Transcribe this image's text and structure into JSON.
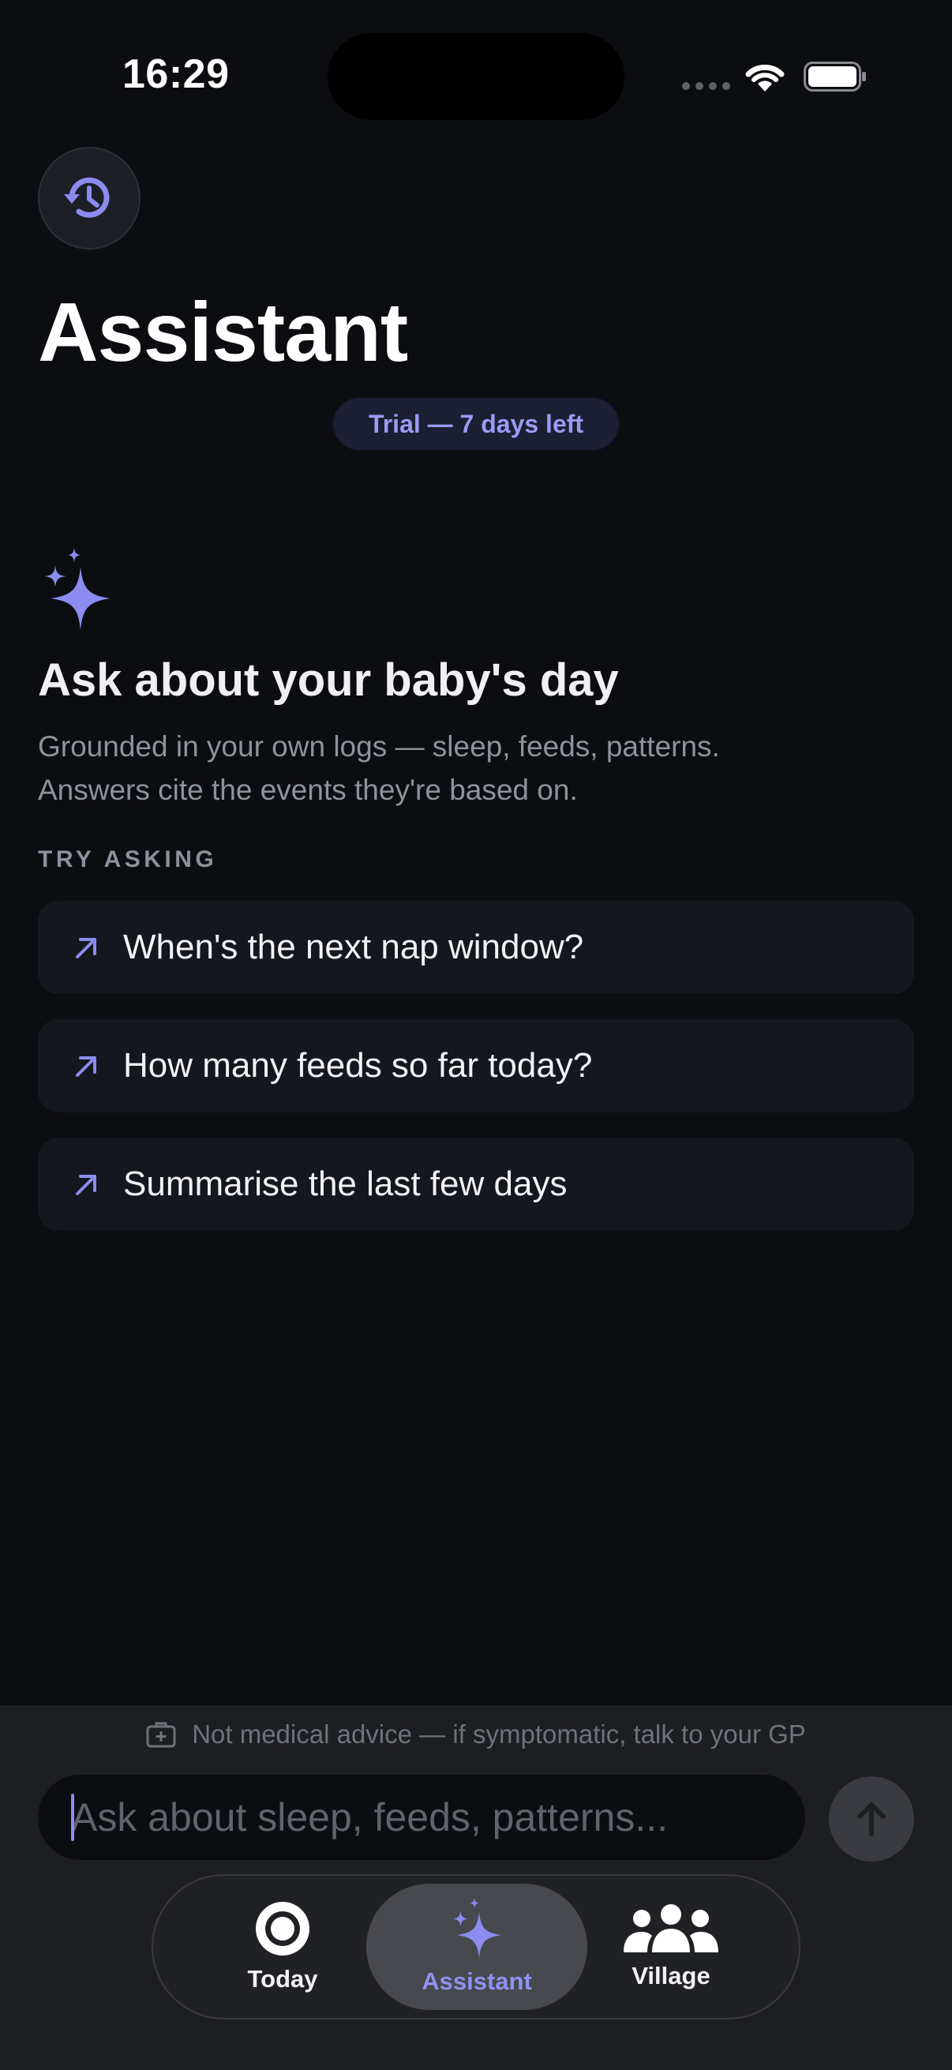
{
  "status_bar": {
    "time": "16:29"
  },
  "header": {
    "title": "Assistant",
    "trial_badge": "Trial — 7 days left"
  },
  "intro": {
    "title": "Ask about your baby's day",
    "text_line1": "Grounded in your own logs — sleep, feeds, patterns.",
    "text_line2": "Answers cite the events they're based on."
  },
  "suggestions": {
    "section_label": "TRY ASKING",
    "items": [
      {
        "label": "When's the next nap window?"
      },
      {
        "label": "How many feeds so far today?"
      },
      {
        "label": "Summarise the last few days"
      }
    ]
  },
  "composer": {
    "disclaimer": "Not medical advice — if symptomatic, talk to your GP",
    "placeholder": "Ask about sleep, feeds, patterns..."
  },
  "tabbar": {
    "tabs": [
      {
        "label": "Today",
        "icon": "circle-record-icon"
      },
      {
        "label": "Assistant",
        "icon": "sparkles-icon",
        "active": true
      },
      {
        "label": "Village",
        "icon": "people-group-icon"
      }
    ]
  },
  "colors": {
    "background": "#0c0d11",
    "accent": "#8b8cf0",
    "card": "#15171e",
    "panel": "#1d1e22"
  }
}
